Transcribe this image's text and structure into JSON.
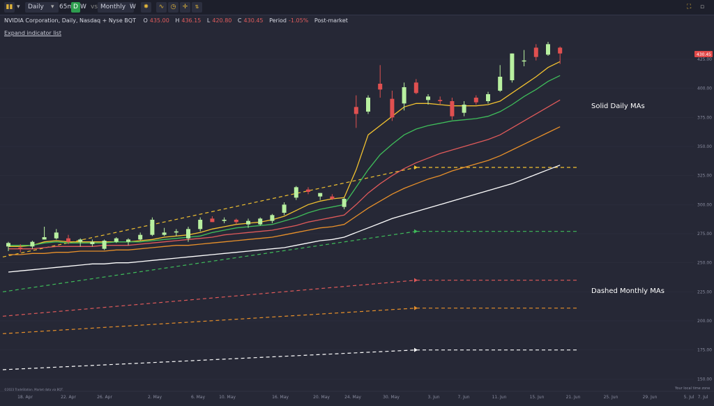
{
  "toolbar": {
    "interval": "Daily",
    "interval_65": "65m",
    "d_toggle": "D",
    "w_toggle": "W",
    "vs_label": "vs",
    "compare_interval": "Monthly",
    "compare_w": "W",
    "icon_names": [
      "candlestick-icon",
      "caret-down-icon",
      "gear-icon",
      "indicator-icon",
      "clock-icon",
      "crosshair-icon",
      "compare-icon",
      "fullscreen-icon",
      "window-icon"
    ]
  },
  "info": {
    "symbol": "NVIDIA Corporation, Daily, Nasdaq + Nyse BQT",
    "o_label": "O",
    "o": "435.00",
    "h_label": "H",
    "h": "436.15",
    "l_label": "L",
    "l": "420.80",
    "c_label": "C",
    "c": "430.45",
    "period_label": "Period",
    "period": "-1.05%",
    "session": "Post-market"
  },
  "expand_label": "Expand indicator list",
  "footer": {
    "credit": "©2023 TradeStation. Market data via BQT.",
    "timezone": "Your local time zone"
  },
  "colors": {
    "background": "#262836",
    "up": "#b8f0a0",
    "down": "#e05050",
    "ma_yellow": "#f2c230",
    "ma_green": "#3fbd5a",
    "ma_red": "#e05a5a",
    "ma_orange": "#e8902a",
    "ma_white": "#ffffff",
    "last_price_tag": "#e04848"
  },
  "chart_data": {
    "type": "candlestick",
    "y_ticks": [
      150,
      175,
      200,
      225,
      250,
      275,
      300,
      325,
      350,
      375,
      400,
      425
    ],
    "ylim": [
      140,
      440
    ],
    "x_ticks": [
      "18. Apr",
      "22. Apr",
      "26. Apr",
      "2. May",
      "6. May",
      "10. May",
      "16. May",
      "20. May",
      "24. May",
      "30. May",
      "3. Jun",
      "7. Jun",
      "11. Jun",
      "15. Jun",
      "21. Jun",
      "25. Jun",
      "29. Jun",
      "5. Jul",
      "7. Jul"
    ],
    "last_price": "430.45",
    "annotations": [
      "Solid Daily MAs",
      "Dashed Monthly MAs"
    ],
    "candles": [
      {
        "o": 264,
        "h": 268,
        "l": 260,
        "c": 267
      },
      {
        "o": 263,
        "h": 266,
        "l": 259,
        "c": 262
      },
      {
        "o": 264,
        "h": 269,
        "l": 262,
        "c": 268
      },
      {
        "o": 270,
        "h": 281,
        "l": 270,
        "c": 272
      },
      {
        "o": 271,
        "h": 279,
        "l": 270,
        "c": 276
      },
      {
        "o": 271,
        "h": 274,
        "l": 266,
        "c": 268
      },
      {
        "o": 268,
        "h": 271,
        "l": 264,
        "c": 270
      },
      {
        "o": 266,
        "h": 270,
        "l": 264,
        "c": 268
      },
      {
        "o": 262,
        "h": 270,
        "l": 261,
        "c": 269
      },
      {
        "o": 268,
        "h": 272,
        "l": 267,
        "c": 271
      },
      {
        "o": 268,
        "h": 271,
        "l": 265,
        "c": 270
      },
      {
        "o": 270,
        "h": 276,
        "l": 269,
        "c": 274
      },
      {
        "o": 274,
        "h": 289,
        "l": 273,
        "c": 287
      },
      {
        "o": 274,
        "h": 280,
        "l": 273,
        "c": 276
      },
      {
        "o": 276,
        "h": 279,
        "l": 273,
        "c": 277
      },
      {
        "o": 271,
        "h": 281,
        "l": 268,
        "c": 279
      },
      {
        "o": 279,
        "h": 289,
        "l": 277,
        "c": 287
      },
      {
        "o": 288,
        "h": 290,
        "l": 285,
        "c": 285
      },
      {
        "o": 286,
        "h": 289,
        "l": 284,
        "c": 287
      },
      {
        "o": 287,
        "h": 288,
        "l": 283,
        "c": 285
      },
      {
        "o": 283,
        "h": 288,
        "l": 280,
        "c": 286
      },
      {
        "o": 283,
        "h": 289,
        "l": 282,
        "c": 288
      },
      {
        "o": 286,
        "h": 292,
        "l": 284,
        "c": 291
      },
      {
        "o": 293,
        "h": 302,
        "l": 291,
        "c": 300
      },
      {
        "o": 306,
        "h": 316,
        "l": 304,
        "c": 315
      },
      {
        "o": 313,
        "h": 315,
        "l": 309,
        "c": 311
      },
      {
        "o": 307,
        "h": 310,
        "l": 304,
        "c": 310
      },
      {
        "o": 307,
        "h": 309,
        "l": 304,
        "c": 305
      },
      {
        "o": 298,
        "h": 306,
        "l": 296,
        "c": 305
      },
      {
        "o": 384,
        "h": 394,
        "l": 366,
        "c": 378
      },
      {
        "o": 380,
        "h": 394,
        "l": 378,
        "c": 392
      },
      {
        "o": 404,
        "h": 420,
        "l": 392,
        "c": 399
      },
      {
        "o": 391,
        "h": 398,
        "l": 372,
        "c": 375
      },
      {
        "o": 387,
        "h": 405,
        "l": 381,
        "c": 401
      },
      {
        "o": 405,
        "h": 408,
        "l": 395,
        "c": 396
      },
      {
        "o": 390,
        "h": 395,
        "l": 386,
        "c": 393
      },
      {
        "o": 390,
        "h": 393,
        "l": 386,
        "c": 389
      },
      {
        "o": 389,
        "h": 392,
        "l": 373,
        "c": 376
      },
      {
        "o": 379,
        "h": 389,
        "l": 376,
        "c": 386
      },
      {
        "o": 392,
        "h": 394,
        "l": 386,
        "c": 388
      },
      {
        "o": 389,
        "h": 397,
        "l": 387,
        "c": 395
      },
      {
        "o": 398,
        "h": 420,
        "l": 397,
        "c": 410
      },
      {
        "o": 407,
        "h": 430,
        "l": 405,
        "c": 430
      },
      {
        "o": 424,
        "h": 433,
        "l": 419,
        "c": 424
      },
      {
        "o": 435,
        "h": 438,
        "l": 424,
        "c": 427
      },
      {
        "o": 429,
        "h": 440,
        "l": 428,
        "c": 438
      },
      {
        "o": 435,
        "h": 436,
        "l": 421,
        "c": 430
      }
    ],
    "solid_daily_ma": [
      {
        "name": "",
        "color": "#f2c230",
        "values": [
          264,
          264,
          265,
          268,
          269,
          268,
          268,
          268,
          268,
          268,
          268,
          269,
          270,
          272,
          273,
          274,
          276,
          279,
          281,
          283,
          284,
          285,
          287,
          290,
          295,
          300,
          303,
          305,
          306,
          330,
          360,
          368,
          376,
          384,
          387,
          387,
          386,
          385,
          385,
          385,
          386,
          389,
          396,
          403,
          410,
          418,
          423
        ]
      },
      {
        "name": "",
        "color": "#3fbd5a",
        "values": [
          265,
          265,
          265,
          267,
          268,
          267,
          267,
          267,
          267,
          268,
          268,
          268,
          269,
          270,
          271,
          272,
          273,
          276,
          278,
          280,
          281,
          282,
          283,
          286,
          289,
          293,
          296,
          298,
          300,
          315,
          330,
          343,
          352,
          360,
          365,
          368,
          370,
          372,
          373,
          374,
          376,
          380,
          386,
          393,
          399,
          406,
          411
        ]
      },
      {
        "name": "",
        "color": "#e05a5a",
        "values": [
          262,
          262,
          262,
          263,
          264,
          264,
          264,
          264,
          265,
          265,
          265,
          266,
          267,
          268,
          269,
          270,
          271,
          272,
          274,
          275,
          276,
          277,
          278,
          280,
          282,
          285,
          287,
          289,
          291,
          300,
          310,
          318,
          325,
          331,
          336,
          340,
          344,
          347,
          350,
          353,
          356,
          360,
          366,
          372,
          378,
          384,
          390
        ]
      },
      {
        "name": "",
        "color": "#e8902a",
        "values": [
          257,
          257,
          258,
          258,
          259,
          259,
          260,
          260,
          260,
          261,
          261,
          262,
          263,
          264,
          265,
          265,
          266,
          267,
          268,
          269,
          270,
          271,
          272,
          274,
          276,
          278,
          280,
          281,
          283,
          290,
          297,
          303,
          309,
          314,
          318,
          322,
          325,
          329,
          332,
          335,
          338,
          342,
          347,
          352,
          357,
          362,
          367
        ]
      },
      {
        "name": "",
        "color": "#ffffff",
        "values": [
          242,
          243,
          244,
          245,
          246,
          247,
          248,
          249,
          249,
          250,
          250,
          251,
          252,
          253,
          254,
          255,
          256,
          257,
          258,
          259,
          260,
          261,
          262,
          263,
          265,
          267,
          269,
          270,
          272,
          276,
          280,
          284,
          288,
          291,
          294,
          297,
          300,
          303,
          306,
          309,
          312,
          315,
          318,
          322,
          326,
          330,
          334
        ]
      }
    ],
    "dashed_monthly_ma": [
      {
        "name": "",
        "color": "#f2c230",
        "start": 255,
        "end": 332,
        "flat": 332
      },
      {
        "name": "",
        "color": "#3fbd5a",
        "start": 225,
        "end": 277,
        "flat": 277
      },
      {
        "name": "",
        "color": "#e05a5a",
        "start": 204,
        "end": 235,
        "flat": 235
      },
      {
        "name": "",
        "color": "#e8902a",
        "start": 189,
        "end": 211,
        "flat": 211
      },
      {
        "name": "",
        "color": "#ffffff",
        "start": 158,
        "end": 175,
        "flat": 175
      }
    ]
  }
}
